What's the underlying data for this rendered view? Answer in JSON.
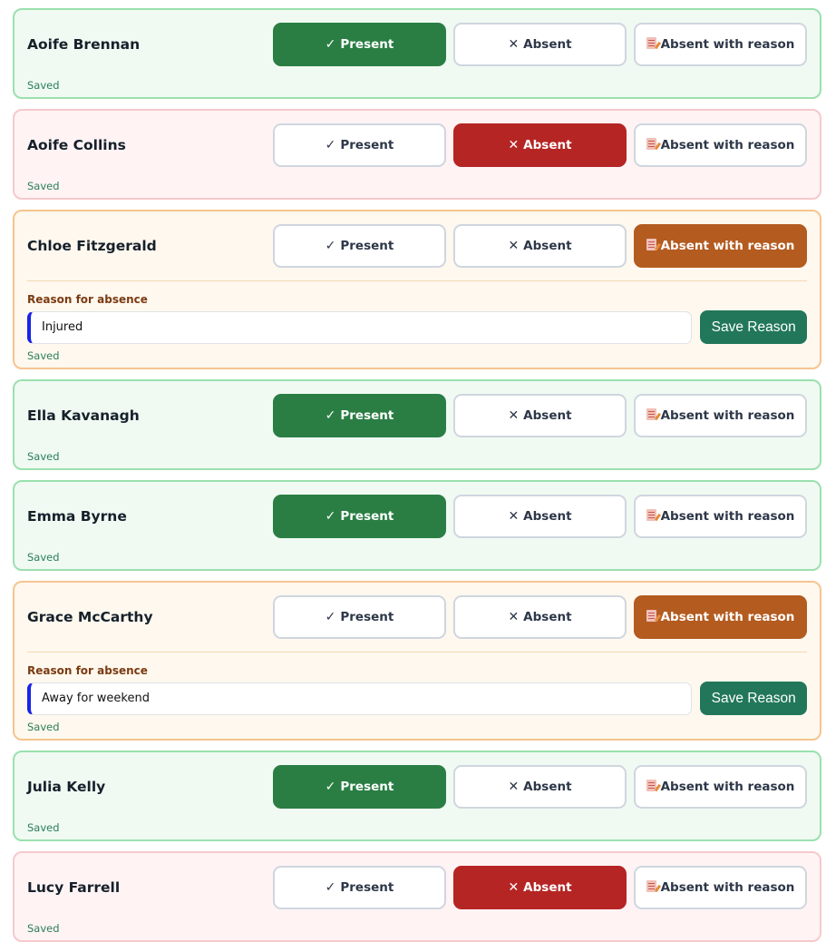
{
  "labels": {
    "present": "Present",
    "absent": "Absent",
    "absent_reason": "Absent with reason",
    "reason_label": "Reason for absence",
    "save_reason": "Save Reason",
    "saved": "Saved"
  },
  "icons": {
    "present": "check-icon",
    "absent": "x-icon",
    "absent_reason": "memo-icon"
  },
  "colors": {
    "present": "#2a7e44",
    "absent": "#b52524",
    "absent_reason": "#b45b20",
    "save_button": "#22775a"
  },
  "players": [
    {
      "name": "Aoife Brennan",
      "status": "present",
      "status_text": "Saved"
    },
    {
      "name": "Aoife Collins",
      "status": "absent",
      "status_text": "Saved"
    },
    {
      "name": "Chloe Fitzgerald",
      "status": "absent_reason",
      "reason": "Injured",
      "status_text": "Saved"
    },
    {
      "name": "Ella Kavanagh",
      "status": "present",
      "status_text": "Saved"
    },
    {
      "name": "Emma Byrne",
      "status": "present",
      "status_text": "Saved"
    },
    {
      "name": "Grace McCarthy",
      "status": "absent_reason",
      "reason": "Away for weekend",
      "status_text": "Saved"
    },
    {
      "name": "Julia Kelly",
      "status": "present",
      "status_text": "Saved"
    },
    {
      "name": "Lucy Farrell",
      "status": "absent",
      "status_text": "Saved"
    }
  ]
}
